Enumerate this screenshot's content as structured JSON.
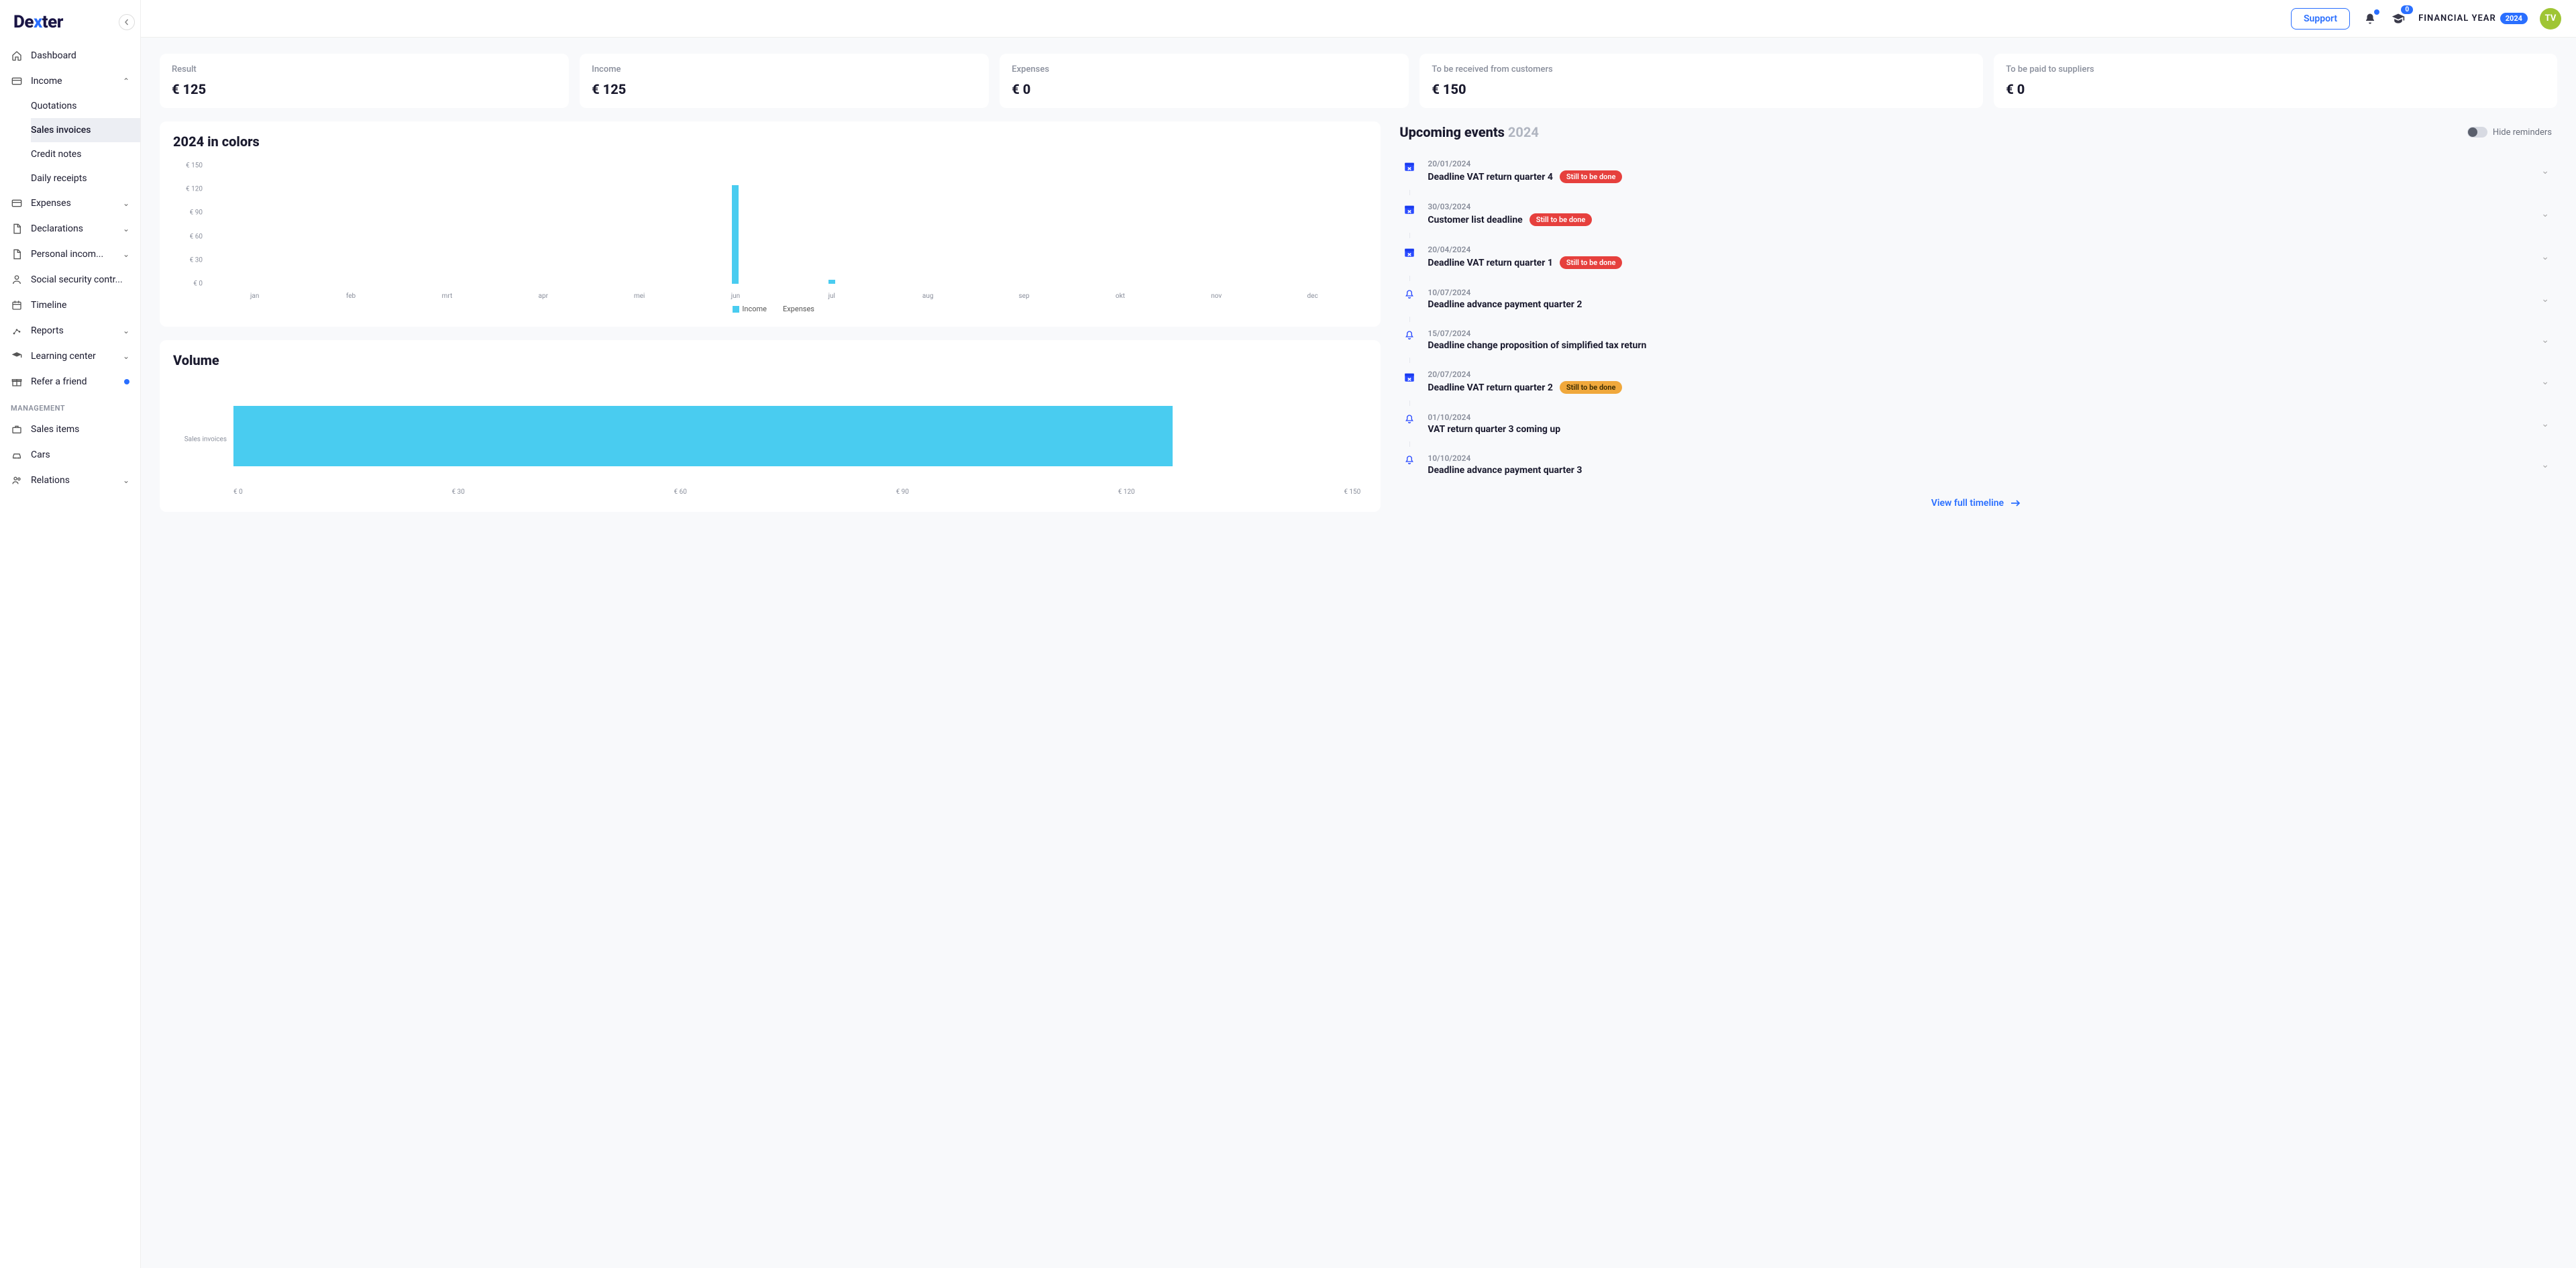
{
  "brand": {
    "name_part1": "De",
    "name_x": "x",
    "name_part2": "ter"
  },
  "topbar": {
    "support": "Support",
    "notif_badge": "0",
    "fy_label": "FINANCIAL YEAR",
    "fy_year": "2024",
    "avatar_initials": "TV"
  },
  "sidebar": {
    "items": [
      {
        "label": "Dashboard",
        "icon": "home"
      },
      {
        "label": "Income",
        "icon": "card",
        "expanded": true,
        "children": [
          {
            "label": "Quotations"
          },
          {
            "label": "Sales invoices",
            "active": true
          },
          {
            "label": "Credit notes"
          },
          {
            "label": "Daily receipts"
          }
        ]
      },
      {
        "label": "Expenses",
        "icon": "card",
        "expandable": true
      },
      {
        "label": "Declarations",
        "icon": "doc",
        "expandable": true
      },
      {
        "label": "Personal incom...",
        "icon": "doc",
        "expandable": true
      },
      {
        "label": "Social security contr...",
        "icon": "person"
      },
      {
        "label": "Timeline",
        "icon": "calendar"
      },
      {
        "label": "Reports",
        "icon": "reports",
        "expandable": true
      },
      {
        "label": "Learning center",
        "icon": "grad",
        "expandable": true
      },
      {
        "label": "Refer a friend",
        "icon": "gift",
        "dot": true
      }
    ],
    "section_management": "MANAGEMENT",
    "management": [
      {
        "label": "Sales items",
        "icon": "briefcase"
      },
      {
        "label": "Cars",
        "icon": "car"
      },
      {
        "label": "Relations",
        "icon": "people",
        "expandable": true
      }
    ]
  },
  "stats": [
    {
      "label": "Result",
      "value": "€ 125"
    },
    {
      "label": "Income",
      "value": "€ 125"
    },
    {
      "label": "Expenses",
      "value": "€ 0"
    },
    {
      "label": "To be received from customers",
      "value": "€ 150",
      "wide": true
    },
    {
      "label": "To be paid to suppliers",
      "value": "€ 0",
      "wide": true
    }
  ],
  "chart_title": "2024 in colors",
  "volume_title": "Volume",
  "events_title_prefix": "Upcoming events ",
  "events_title_year": "2024",
  "hide_reminders": "Hide reminders",
  "events": [
    {
      "date": "20/01/2024",
      "title": "Deadline VAT return quarter 4",
      "pill": "Still to be done",
      "pill_color": "red",
      "icon": "cal"
    },
    {
      "date": "30/03/2024",
      "title": "Customer list deadline",
      "pill": "Still to be done",
      "pill_color": "red",
      "icon": "cal"
    },
    {
      "date": "20/04/2024",
      "title": "Deadline VAT return quarter 1",
      "pill": "Still to be done",
      "pill_color": "red",
      "icon": "cal"
    },
    {
      "date": "10/07/2024",
      "title": "Deadline advance payment quarter 2",
      "icon": "bell"
    },
    {
      "date": "15/07/2024",
      "title": "Deadline change proposition of simplified tax return",
      "icon": "bell"
    },
    {
      "date": "20/07/2024",
      "title": "Deadline VAT return quarter 2",
      "pill": "Still to be done",
      "pill_color": "orange",
      "icon": "cal"
    },
    {
      "date": "01/10/2024",
      "title": "VAT return quarter 3 coming up",
      "icon": "bell"
    },
    {
      "date": "10/10/2024",
      "title": "Deadline advance payment quarter 3",
      "icon": "bell"
    }
  ],
  "view_full_timeline": "View full timeline",
  "chart_data": [
    {
      "type": "bar",
      "title": "2024 in colors",
      "ylabel": "€",
      "ylim": [
        0,
        150
      ],
      "y_ticks": [
        0,
        30,
        60,
        90,
        120,
        150
      ],
      "categories": [
        "jan",
        "feb",
        "mrt",
        "apr",
        "mei",
        "jun",
        "jul",
        "aug",
        "sep",
        "okt",
        "nov",
        "dec"
      ],
      "series": [
        {
          "name": "Income",
          "color": "#49ccf0",
          "values": [
            0,
            0,
            0,
            0,
            0,
            125,
            5,
            0,
            0,
            0,
            0,
            0
          ]
        },
        {
          "name": "Expenses",
          "color": "#f7d43a",
          "values": [
            0,
            0,
            0,
            0,
            0,
            0,
            0,
            0,
            0,
            0,
            0,
            0
          ]
        }
      ]
    },
    {
      "type": "bar-horizontal",
      "title": "Volume",
      "categories": [
        "Sales invoices"
      ],
      "values": [
        125
      ],
      "xlabel": "€",
      "xlim": [
        0,
        150
      ],
      "x_ticks": [
        0,
        30,
        60,
        90,
        120,
        150
      ]
    }
  ]
}
